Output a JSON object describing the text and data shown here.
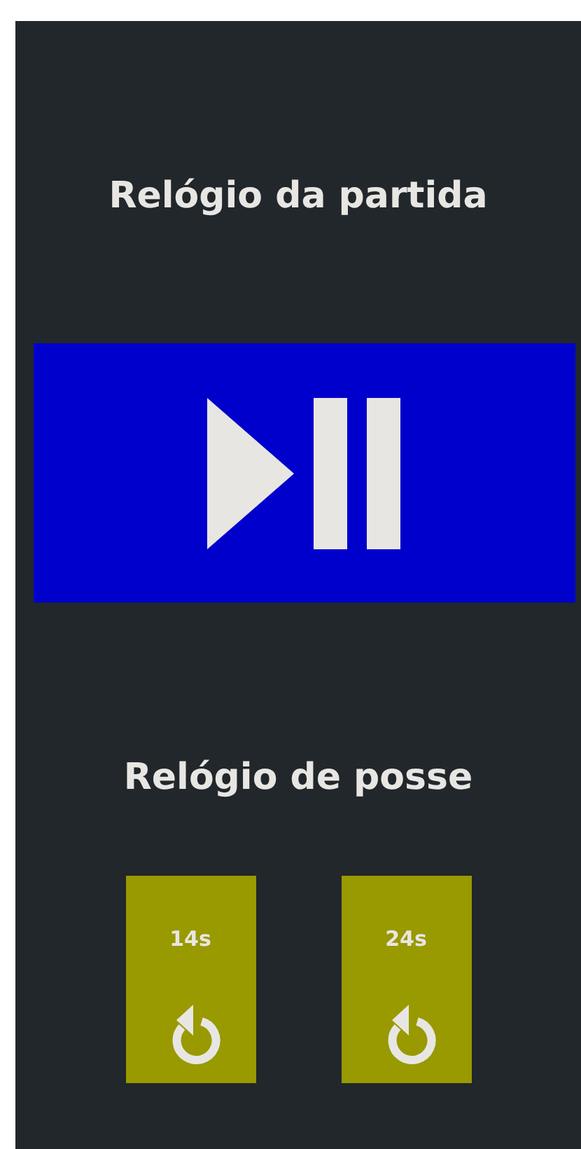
{
  "match_clock": {
    "title": "Relógio da partida"
  },
  "shot_clock": {
    "title": "Relógio de posse",
    "buttons": [
      {
        "label": "14s"
      },
      {
        "label": "24s"
      }
    ]
  }
}
